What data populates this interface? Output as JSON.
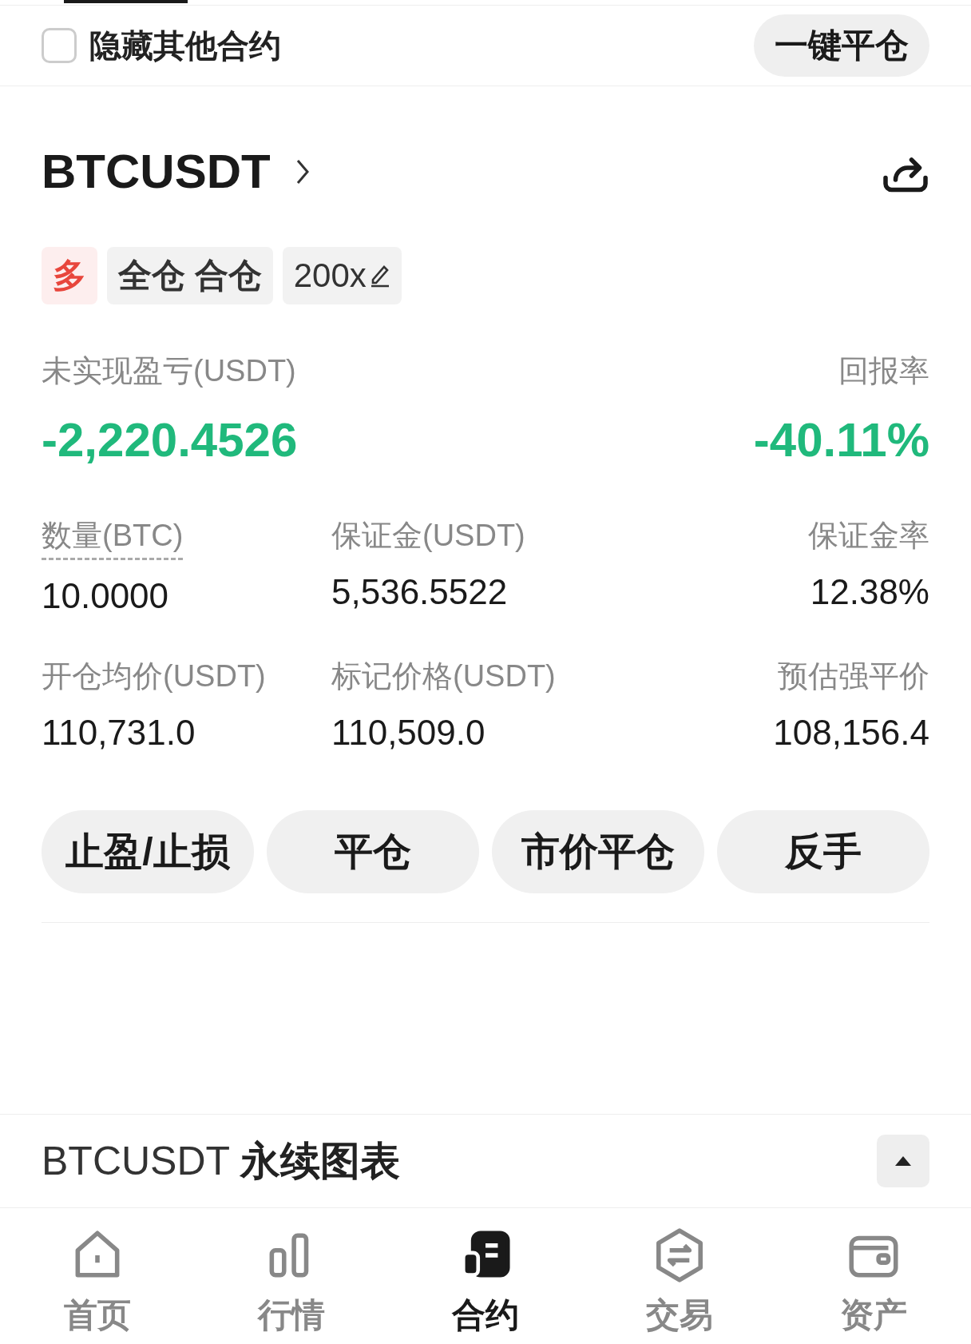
{
  "header": {
    "hide_others": {
      "label": "隐藏其他合约",
      "checked": false
    },
    "close_all_button": "一键平仓"
  },
  "position": {
    "symbol": "BTCUSDT",
    "tags": [
      {
        "kind": "side",
        "label": "多",
        "color": "#e8463c"
      },
      {
        "kind": "mode",
        "label": "全仓 合仓"
      },
      {
        "kind": "leverage",
        "label": "200x"
      }
    ],
    "pnl": {
      "label": "未实现盈亏(USDT)",
      "value": "-2,220.4526"
    },
    "roe": {
      "label": "回报率",
      "value": "-40.11%"
    },
    "stats": [
      {
        "label": "数量(BTC)",
        "value": "10.0000",
        "hint": true
      },
      {
        "label": "保证金(USDT)",
        "value": "5,536.5522",
        "hint": false
      },
      {
        "label": "保证金率",
        "value": "12.38%",
        "hint": false
      },
      {
        "label": "开仓均价(USDT)",
        "value": "110,731.0",
        "hint": false
      },
      {
        "label": "标记价格(USDT)",
        "value": "110,509.0",
        "hint": false
      },
      {
        "label": "预估强平价",
        "value": "108,156.4",
        "hint": false
      }
    ],
    "actions": [
      "止盈/止损",
      "平仓",
      "市价平仓",
      "反手"
    ]
  },
  "chart_section": {
    "title": "BTCUSDT **永续图表**",
    "expanded": true
  },
  "bottom_nav": [
    {
      "kind": "home",
      "label": "首页",
      "selected": false
    },
    {
      "kind": "market",
      "label": "行情",
      "selected": false
    },
    {
      "kind": "futures",
      "label": "合约",
      "selected": true
    },
    {
      "kind": "trade",
      "label": "交易",
      "selected": false
    },
    {
      "kind": "assets",
      "label": "资产",
      "selected": false
    }
  ]
}
